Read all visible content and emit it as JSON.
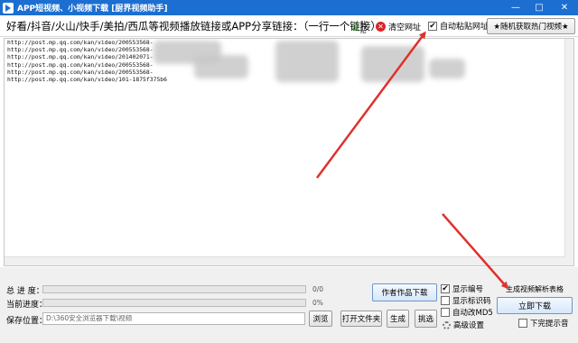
{
  "window": {
    "title": "APP短视频、小视频下载 [厨界视频助手]",
    "controls": {
      "minimize": "—",
      "maximize": "□",
      "close": "✕"
    }
  },
  "toolbar": {
    "prompt": "好看/抖音/火山/快手/美拍/西瓜等视频播放链接或APP分享链接：（一行一个链接）",
    "paste_label": "粘贴",
    "paste_icon": "green-down-arrow",
    "clear_label": "清空网址",
    "clear_icon": "red-x-circle",
    "auto_paste_label": "自动粘贴网址",
    "auto_paste_checked": true,
    "random_label": "★随机获取热门视频★"
  },
  "links": [
    "http://post.mp.qq.com/kan/video/200553568-",
    "http://post.mp.qq.com/kan/video/200553568-",
    "http://post.mp.qq.com/kan/video/201402071-",
    "http://post.mp.qq.com/kan/video/200553568-",
    "http://post.mp.qq.com/kan/video/200553568-",
    "http://post.mp.qq.com/kan/video/101-1875f375b6"
  ],
  "bottom": {
    "total_progress_label": "总  进  度：",
    "total_progress_text": "0/0",
    "total_progress_value": 0,
    "current_progress_label": "当前进度：",
    "current_progress_text": "0%",
    "current_progress_value": 0,
    "save_label": "保存位置：",
    "save_path": "D:\\360安全浏览器下载\\视频",
    "browse_label": "浏览",
    "open_folder_label": "打开文件夹",
    "generate_label": "生成",
    "pick_label": "挑选",
    "author_download_label": "作者作品下载",
    "show_number_label": "显示编号",
    "show_number_checked": true,
    "show_mark_label": "显示标识码",
    "show_mark_checked": false,
    "auto_md5_label": "自动改MD5",
    "auto_md5_checked": false,
    "advanced_label": "高级设置",
    "gen_table_label": "生成视频解析表格",
    "download_now_label": "立即下载",
    "no_prompt_label": "下完提示音",
    "no_prompt_checked": false
  },
  "colors": {
    "titlebar": "#1c6fd1",
    "annotation_arrow": "#e0312d",
    "progress_fill": "#3aa23a"
  }
}
